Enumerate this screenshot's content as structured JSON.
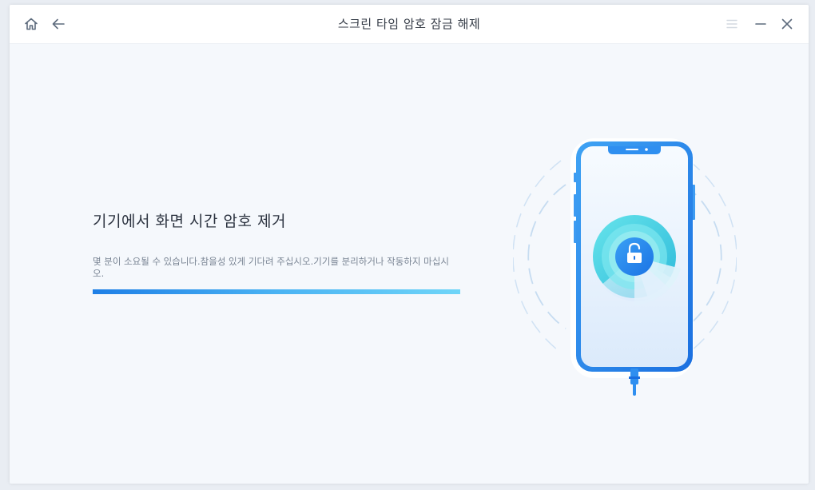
{
  "window": {
    "title": "스크린 타임 암호 잠금 해제"
  },
  "titlebar": {
    "icons": [
      "home-icon",
      "back-arrow-icon",
      "menu-icon",
      "minimize-icon",
      "close-icon"
    ]
  },
  "main": {
    "heading": "기기에서 화면 시간 암호 제거",
    "description": "몇 분이 소요될 수 있습니다.참을성 있게 기다려 주십시오.기기를 분리하거나 작동하지 마십시오.",
    "progress": 1.0
  },
  "colors": {
    "accent": "#1e7fe6",
    "progress_end": "#6fd5f8",
    "title_text": "#333a45",
    "body_text": "#7a8594",
    "background": "#f5f8fc"
  }
}
